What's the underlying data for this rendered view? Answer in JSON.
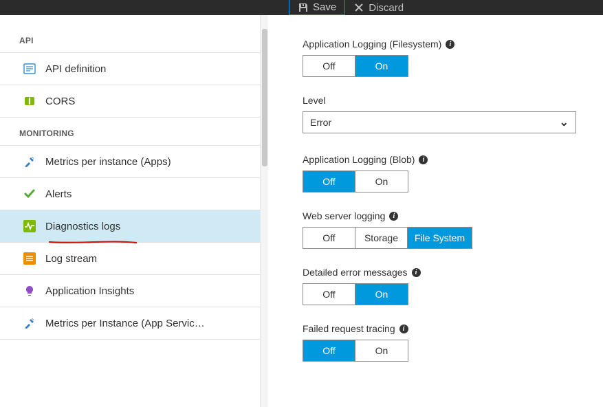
{
  "topbar": {
    "save_label": "Save",
    "discard_label": "Discard"
  },
  "sidebar": {
    "section_api": "API",
    "section_monitoring": "MONITORING",
    "api_items": [
      {
        "label": "API definition",
        "icon": "api-def"
      },
      {
        "label": "CORS",
        "icon": "cors"
      }
    ],
    "monitoring_items": [
      {
        "label": "Metrics per instance (Apps)",
        "icon": "tools"
      },
      {
        "label": "Alerts",
        "icon": "check"
      },
      {
        "label": "Diagnostics logs",
        "icon": "pulse",
        "selected": true
      },
      {
        "label": "Log stream",
        "icon": "stream"
      },
      {
        "label": "Application Insights",
        "icon": "bulb"
      },
      {
        "label": "Metrics per Instance (App Servic…",
        "icon": "tools"
      }
    ]
  },
  "settings": {
    "app_logging_fs": {
      "label": "Application Logging (Filesystem)",
      "off": "Off",
      "on": "On",
      "value": "on"
    },
    "level": {
      "label": "Level",
      "value": "Error"
    },
    "app_logging_blob": {
      "label": "Application Logging (Blob)",
      "off": "Off",
      "on": "On",
      "value": "off"
    },
    "web_server_logging": {
      "label": "Web server logging",
      "off": "Off",
      "storage": "Storage",
      "fs": "File System",
      "value": "fs"
    },
    "detailed_errors": {
      "label": "Detailed error messages",
      "off": "Off",
      "on": "On",
      "value": "on"
    },
    "failed_request": {
      "label": "Failed request tracing",
      "off": "Off",
      "on": "On",
      "value": "off"
    }
  }
}
